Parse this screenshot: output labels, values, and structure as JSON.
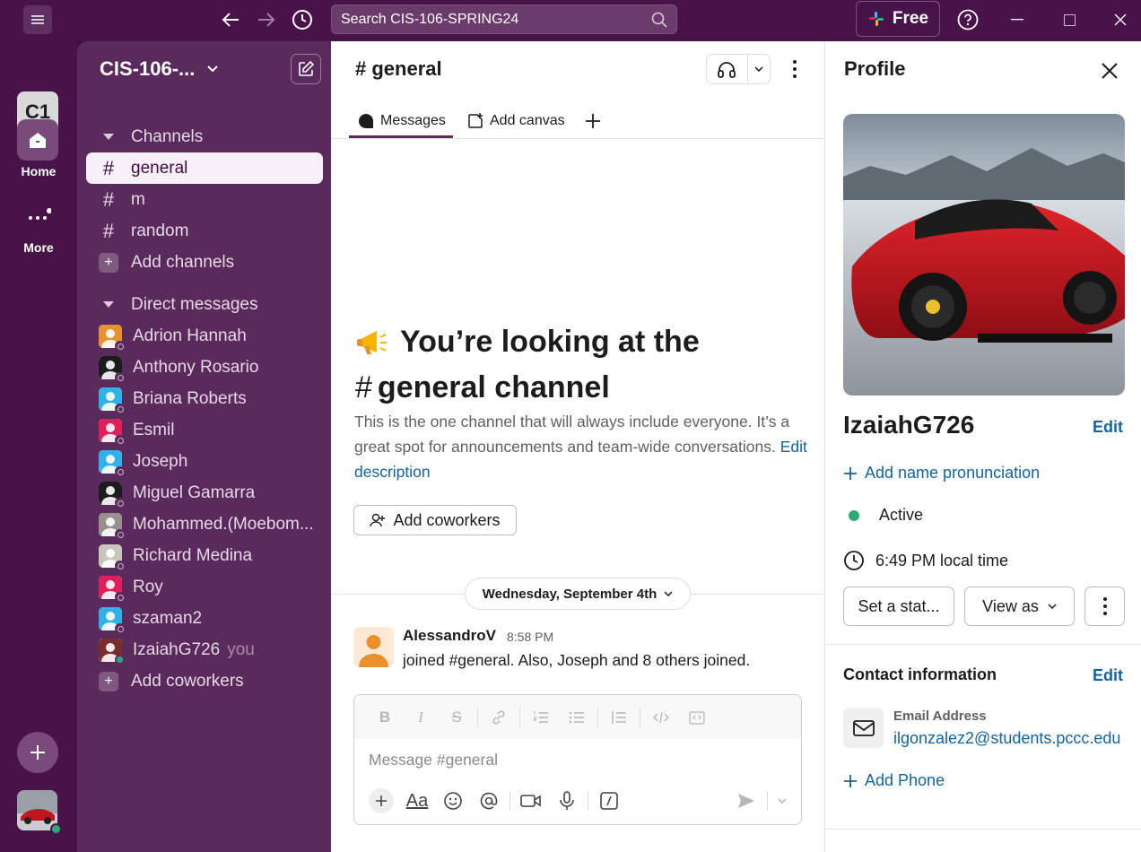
{
  "titlebar": {
    "search_text": "Search CIS-106-SPRING24",
    "free_label": "Free"
  },
  "rail": {
    "workspace_initials": "C1",
    "home_label": "Home",
    "more_label": "More"
  },
  "sidebar": {
    "workspace_name": "CIS-106-...",
    "channels_header": "Channels",
    "channels": [
      "general",
      "m",
      "random"
    ],
    "active_channel": "general",
    "add_channels": "Add channels",
    "dm_header": "Direct messages",
    "dms": [
      {
        "name": "Adrion Hannah",
        "avatar_color": "#e8912d"
      },
      {
        "name": "Anthony Rosario",
        "avatar_color": "#1d1c1d"
      },
      {
        "name": "Briana Roberts",
        "avatar_color": "#2eb2e8"
      },
      {
        "name": "Esmil",
        "avatar_color": "#e01e5a"
      },
      {
        "name": "Joseph",
        "avatar_color": "#2eb2e8"
      },
      {
        "name": "Miguel Gamarra",
        "avatar_color": "#1d1c1d"
      },
      {
        "name": "Mohammed.(Moebom...",
        "avatar_color": "#9a8f8f"
      },
      {
        "name": "Richard Medina",
        "avatar_color": "#c9c6b8"
      },
      {
        "name": "Roy",
        "avatar_color": "#e01e5a"
      },
      {
        "name": "szaman2",
        "avatar_color": "#2eb2e8"
      },
      {
        "name": "IzaiahG726",
        "you": "you",
        "avatar_color": "#7a2b2b"
      }
    ],
    "add_coworkers": "Add coworkers"
  },
  "channel": {
    "title": "# general",
    "tabs": [
      "Messages",
      "Add canvas"
    ],
    "intro_title_1": "You’re looking at the",
    "intro_title_2": "general channel",
    "intro_desc": "This is the one channel that will always include everyone. It’s a great spot for announcements and team-wide conversations.",
    "edit_description": "Edit description",
    "add_coworkers": "Add coworkers",
    "date_divider": "Wednesday, September 4th",
    "message": {
      "author": "AlessandroV",
      "time": "8:58 PM",
      "text": "joined #general. Also, Joseph and 8 others joined."
    },
    "composer_placeholder": "Message #general"
  },
  "profile": {
    "title": "Profile",
    "name": "IzaiahG726",
    "edit": "Edit",
    "add_pronunciation": "Add name pronunciation",
    "status": "Active",
    "local_time": "6:49 PM local time",
    "set_status": "Set a stat...",
    "view_as": "View as",
    "contact_title": "Contact information",
    "contact_edit": "Edit",
    "email_label": "Email Address",
    "email": "ilgonzalez2@students.pccc.edu",
    "add_phone": "Add Phone"
  },
  "colors": {
    "aubergine": "#3f0e40",
    "sidebar": "#5b2a5c",
    "link": "#1264a3",
    "active_green": "#2bac76"
  }
}
